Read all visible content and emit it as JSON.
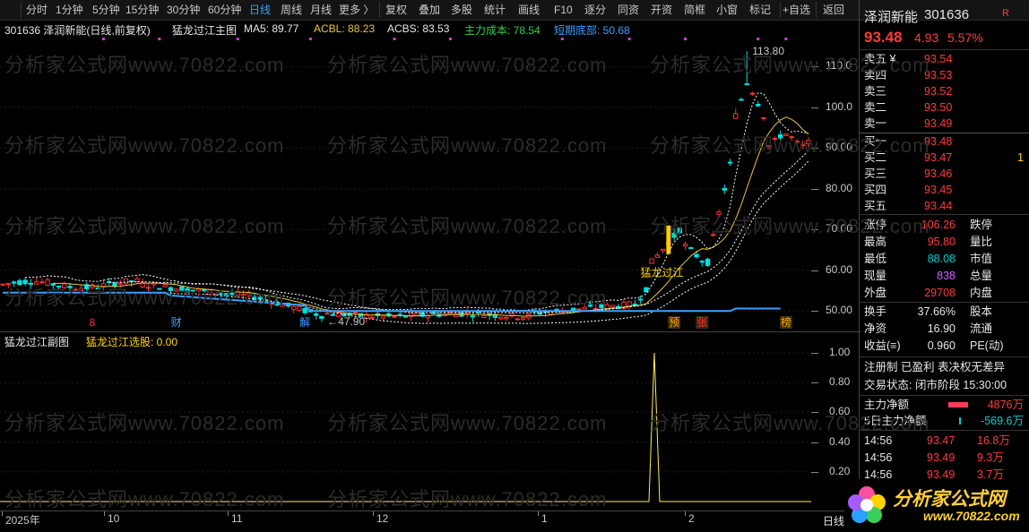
{
  "toolbar": {
    "buttons": [
      "分时",
      "1分钟",
      "5分钟",
      "15分钟",
      "30分钟",
      "60分钟",
      "日线",
      "周线",
      "月线",
      "更多 〉",
      "复权",
      "叠加",
      "多股",
      "统计",
      "画线",
      "F10",
      "逐分",
      "同资",
      "开资",
      "简框",
      "小窗",
      "标记",
      "+自选",
      "返回"
    ],
    "active_index": 6
  },
  "info_bar": {
    "stock": "301636 泽润新能(日线,前复权)",
    "main_name": "猛龙过江主图",
    "ma5": "MA5: 89.77",
    "acbl": "ACBL: 88.23",
    "acbs": "ACBS: 83.53",
    "cost": "主力成本: 78.54",
    "bottom": "短期底部: 50.68"
  },
  "annotations": {
    "high_label": "113.80",
    "low_label": "←47.90",
    "signal_text": "猛龙过江",
    "markers": [
      "8",
      "财",
      "解",
      "预",
      "张",
      "榜"
    ]
  },
  "sub_chart": {
    "title": "猛龙过江副图",
    "indicator": "猛龙过江选股: 0.00",
    "y_ticks": [
      "1.00",
      "0.80",
      "0.60",
      "0.40",
      "0.20"
    ]
  },
  "price_axis": [
    "110.0",
    "100.0",
    "90.00",
    "80.00",
    "70.00",
    "60.00",
    "50.00"
  ],
  "x_axis": [
    "2025年",
    "10",
    "11",
    "12",
    "1",
    "2"
  ],
  "axis_corner": "日线",
  "watermark": "分析家公式网www.70822.com",
  "logo": {
    "name": "分析家公式网",
    "url": "www.70822.com"
  },
  "quote": {
    "name": "泽润新能",
    "code": "301636",
    "price": "93.48",
    "change": "4.93",
    "pct": "5.57%",
    "sell": [
      [
        "卖五",
        "¥",
        "93.54"
      ],
      [
        "卖四",
        "",
        "93.53"
      ],
      [
        "卖三",
        "",
        "93.52"
      ],
      [
        "卖二",
        "",
        "93.50"
      ],
      [
        "卖一",
        "",
        "93.49"
      ]
    ],
    "buy": [
      [
        "买一",
        "93.48",
        ""
      ],
      [
        "买二",
        "93.47",
        "1"
      ],
      [
        "买三",
        "93.46",
        ""
      ],
      [
        "买四",
        "93.45",
        ""
      ],
      [
        "买五",
        "93.44",
        ""
      ]
    ],
    "stats": [
      [
        "涨停",
        "106.26",
        "跌停",
        ""
      ],
      [
        "最高",
        "95.80",
        "量比",
        ""
      ],
      [
        "最低",
        "88.08",
        "市值",
        ""
      ],
      [
        "现量",
        "838",
        "总量",
        ""
      ],
      [
        "外盘",
        "29708",
        "内盘",
        ""
      ]
    ],
    "stats2": [
      [
        "换手",
        "37.66%",
        "股本"
      ],
      [
        "净资",
        "16.90",
        "流通"
      ],
      [
        "收益(≡)",
        "0.960",
        "PE(动)"
      ]
    ],
    "tags": "注册制 已盈利 表决权无差异",
    "trade_state": "交易状态: 闭市阶段 15:30:00",
    "fund": [
      [
        "主力净额",
        "4876万"
      ],
      [
        "5日主力净额",
        "-569.6万"
      ]
    ],
    "ticks": [
      [
        "14:56",
        "93.47",
        "16.8万"
      ],
      [
        "14:56",
        "93.49",
        "9.3万"
      ],
      [
        "14:56",
        "93.49",
        "3.7万"
      ]
    ]
  },
  "chart_data": {
    "type": "candlestick",
    "title": "301636 泽润新能(日线,前复权)",
    "ylim": [
      45,
      118
    ],
    "high": 113.8,
    "low": 47.9,
    "x_ticks": [
      "2025年",
      "10",
      "11",
      "12",
      "1",
      "2"
    ],
    "sub_values": [
      0,
      0,
      0,
      0,
      1,
      0,
      0
    ]
  }
}
